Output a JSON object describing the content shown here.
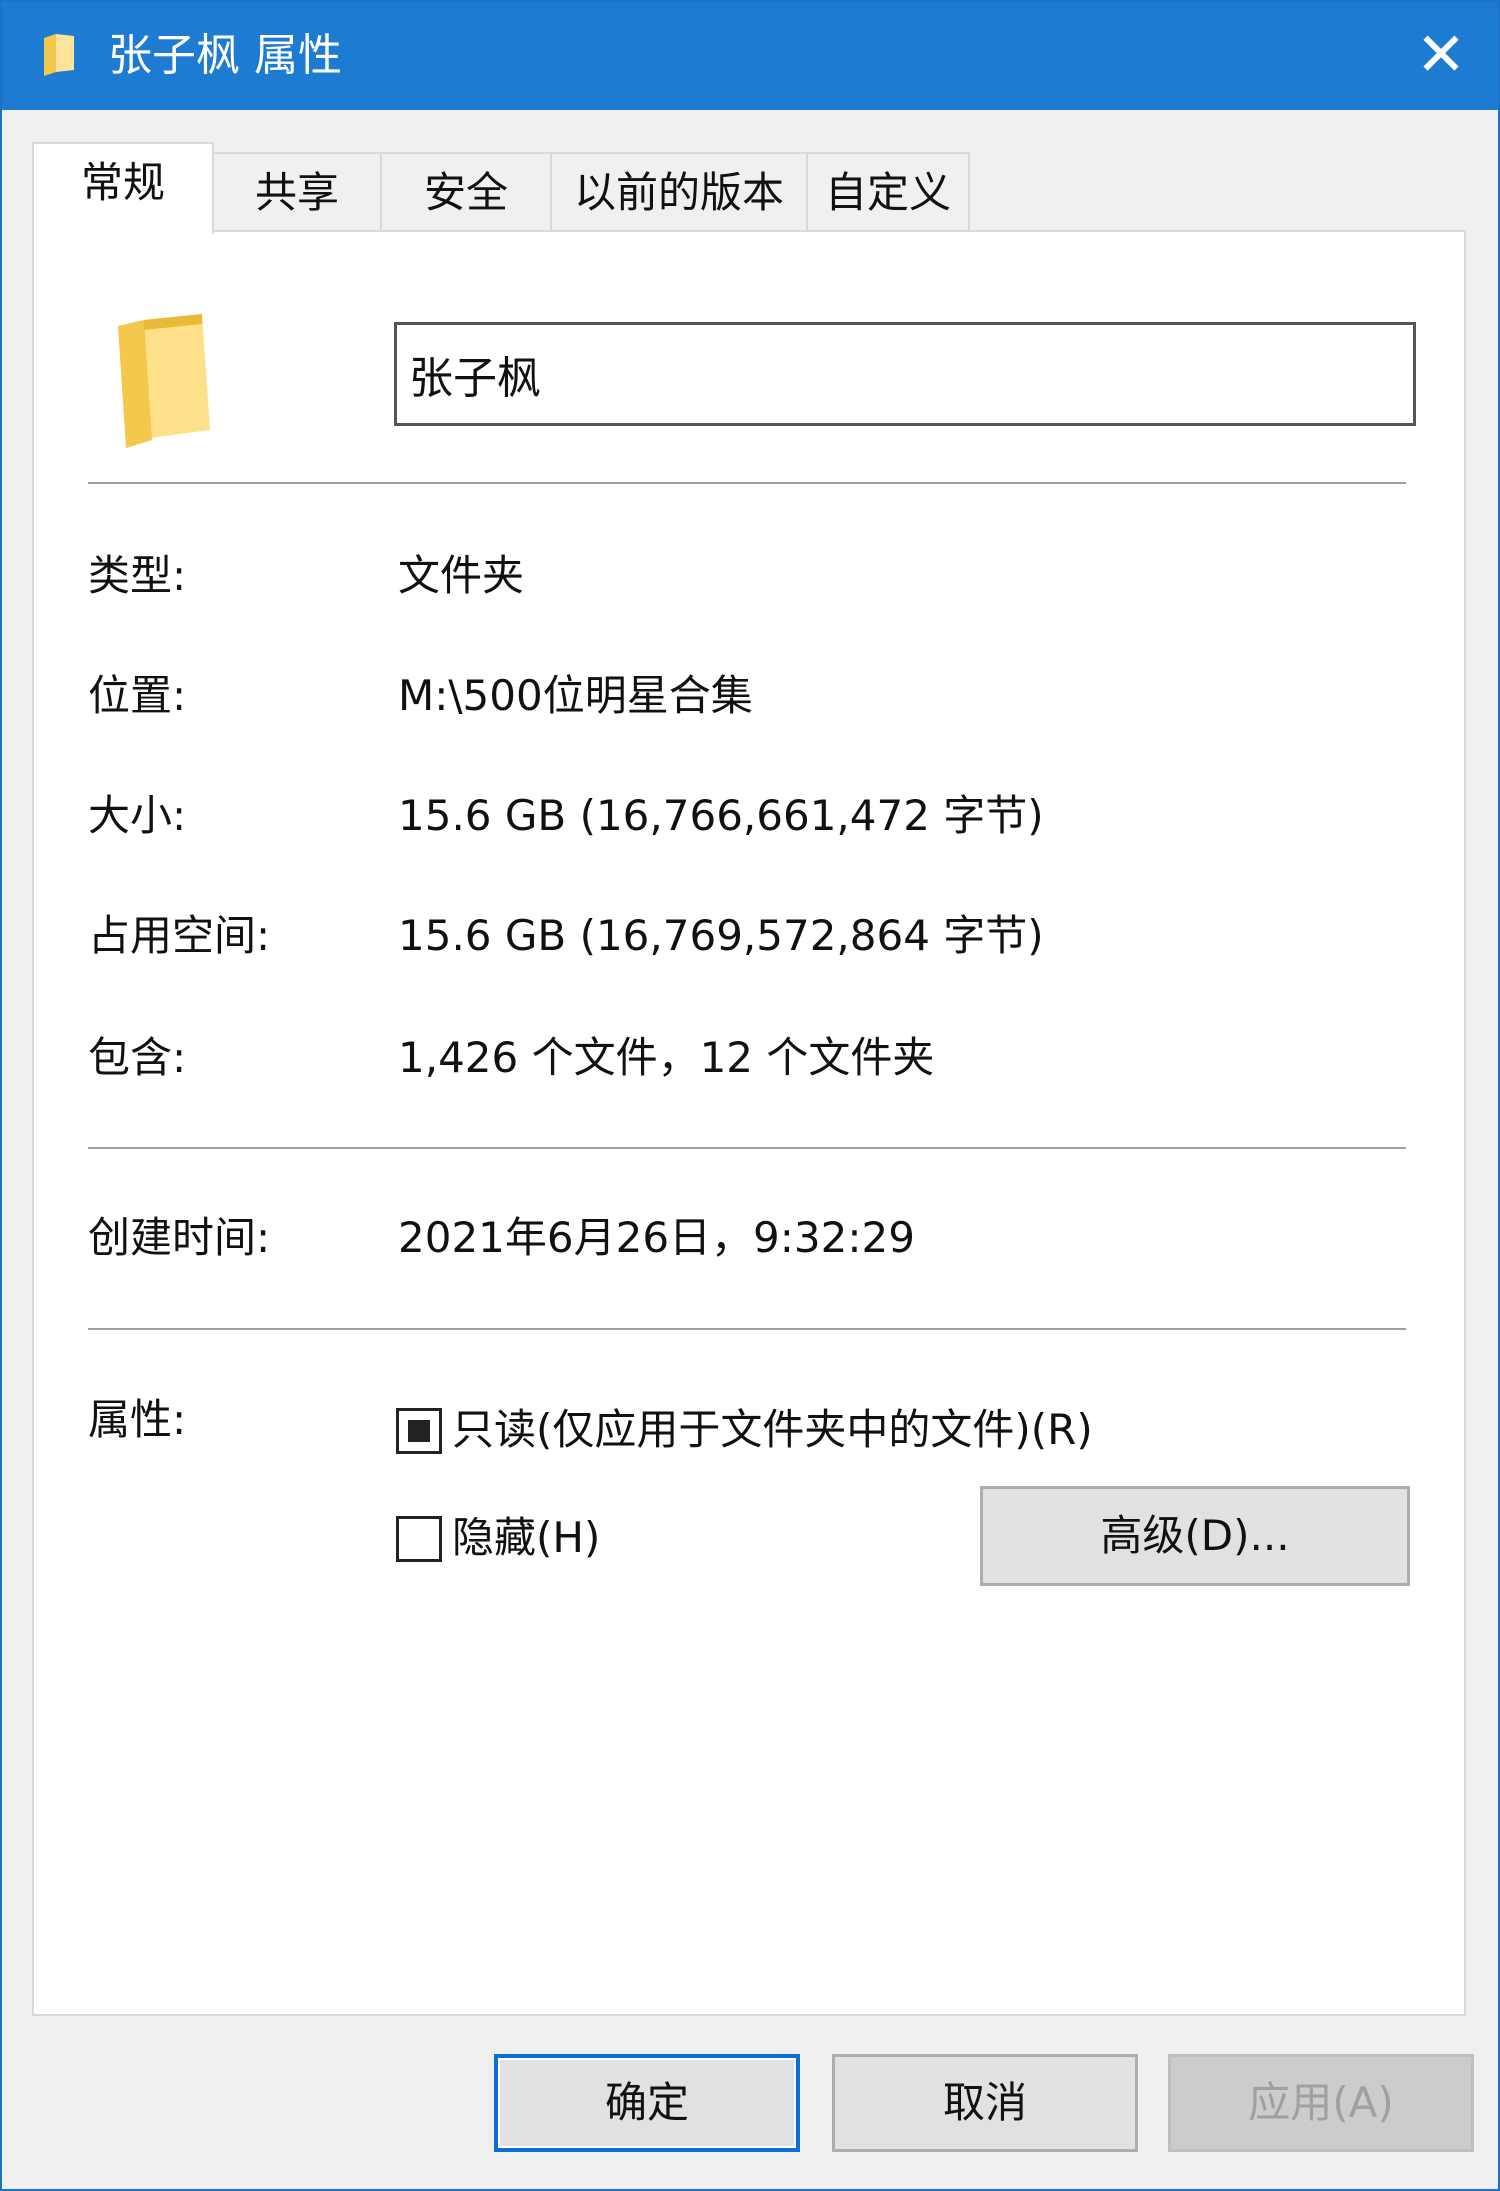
{
  "window": {
    "title": "张子枫 属性",
    "close_glyph": "✕",
    "accent_color": "#1e7bd2"
  },
  "tabs": [
    {
      "label": "常规",
      "active": true
    },
    {
      "label": "共享",
      "active": false
    },
    {
      "label": "安全",
      "active": false
    },
    {
      "label": "以前的版本",
      "active": false
    },
    {
      "label": "自定义",
      "active": false
    }
  ],
  "general": {
    "name_value": "张子枫",
    "folder_icon": "folder-icon",
    "type_label": "类型:",
    "type_value": "文件夹",
    "location_label": "位置:",
    "location_value": "M:\\500位明星合集",
    "size_label": "大小:",
    "size_value": "15.6 GB (16,766,661,472 字节)",
    "size_on_disk_label": "占用空间:",
    "size_on_disk_value": "15.6 GB (16,769,572,864 字节)",
    "contains_label": "包含:",
    "contains_value": "1,426 个文件，12 个文件夹",
    "created_label": "创建时间:",
    "created_value": "2021年6月26日，9:32:29",
    "attributes_label": "属性:",
    "readonly_label": "只读(仅应用于文件夹中的文件)(R)",
    "readonly_state": "indeterminate",
    "hidden_label": "隐藏(H)",
    "hidden_checked": false,
    "advanced_button": "高级(D)..."
  },
  "footer": {
    "ok": "确定",
    "cancel": "取消",
    "apply": "应用(A)"
  }
}
